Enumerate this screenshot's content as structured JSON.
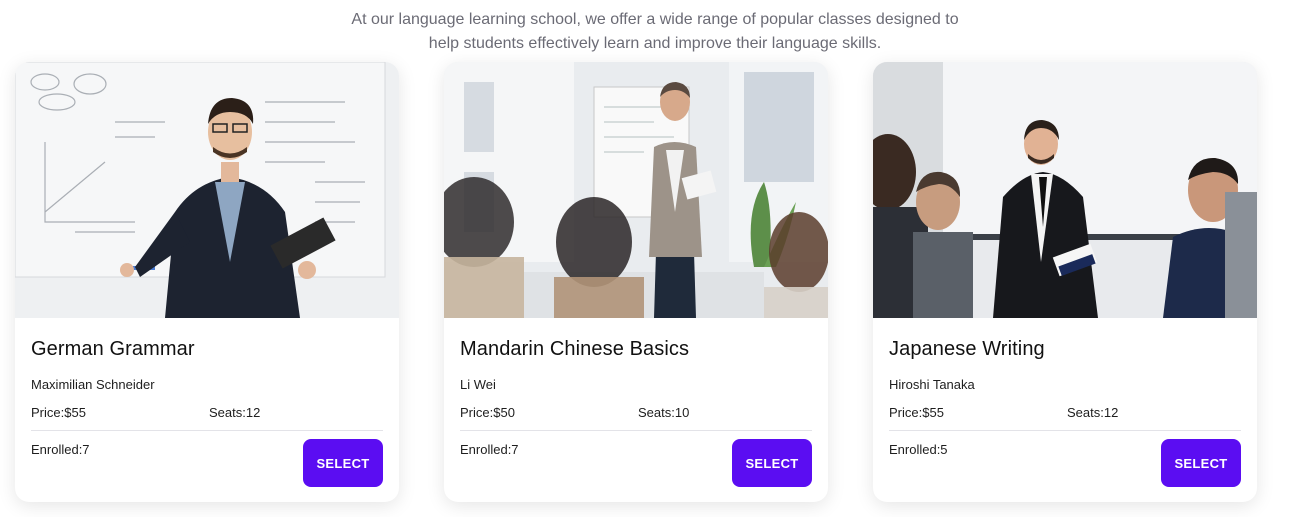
{
  "intro": {
    "line1": "At our language learning school, we offer a wide range of popular classes designed to",
    "line2": "help students effectively learn and improve their language skills."
  },
  "colors": {
    "button": "#5b0df2",
    "intro_text": "#6b6b75"
  },
  "classes": [
    {
      "title": "German Grammar",
      "instructor": "Maximilian Schneider",
      "price": "Price:$55",
      "seats": "Seats:12",
      "enrolled": "Enrolled:7",
      "button": "SELECT",
      "image": "teacher-at-whiteboard-photo"
    },
    {
      "title": "Mandarin Chinese Basics",
      "instructor": "Li Wei",
      "price": "Price:$50",
      "seats": "Seats:10",
      "enrolled": "Enrolled:7",
      "button": "SELECT",
      "image": "teacher-presenting-to-class-photo"
    },
    {
      "title": "Japanese Writing",
      "instructor": "Hiroshi Tanaka",
      "price": "Price:$55",
      "seats": "Seats:12",
      "enrolled": "Enrolled:5",
      "button": "SELECT",
      "image": "speaker-at-meeting-photo"
    }
  ]
}
